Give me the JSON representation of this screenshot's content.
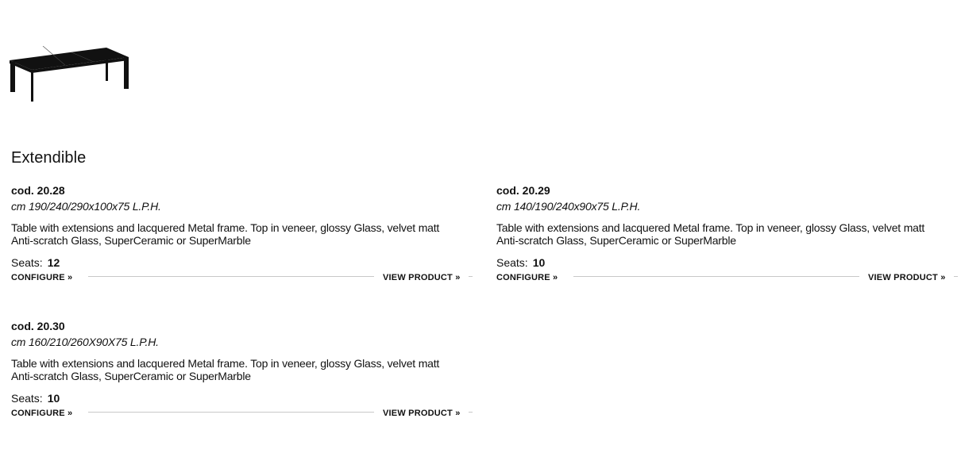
{
  "illustration": {
    "icon": "extendible-table-icon",
    "color": "#111111"
  },
  "section": {
    "title": "Extendible"
  },
  "products": [
    {
      "code": "cod. 20.28",
      "dimensions": "cm 190/240/290x100x75 L.P.H.",
      "description": "Table with extensions and lacquered Metal frame. Top in veneer, glossy Glass, velvet matt Anti-scratch Glass, SuperCeramic or SuperMarble",
      "seats_label": "Seats:",
      "seats_value": "12",
      "configure_label": "CONFIGURE »",
      "view_label": "VIEW PRODUCT »"
    },
    {
      "code": "cod. 20.29",
      "dimensions": "cm 140/190/240x90x75 L.P.H.",
      "description": "Table with extensions and lacquered Metal frame. Top in veneer, glossy Glass, velvet matt Anti-scratch Glass, SuperCeramic or SuperMarble",
      "seats_label": "Seats:",
      "seats_value": "10",
      "configure_label": "CONFIGURE »",
      "view_label": "VIEW PRODUCT »"
    },
    {
      "code": "cod. 20.30",
      "dimensions": "cm 160/210/260X90X75 L.P.H.",
      "description": "Table with extensions and lacquered Metal frame. Top in veneer, glossy Glass, velvet matt Anti-scratch Glass, SuperCeramic or SuperMarble",
      "seats_label": "Seats:",
      "seats_value": "10",
      "configure_label": "CONFIGURE »",
      "view_label": "VIEW PRODUCT »"
    }
  ]
}
